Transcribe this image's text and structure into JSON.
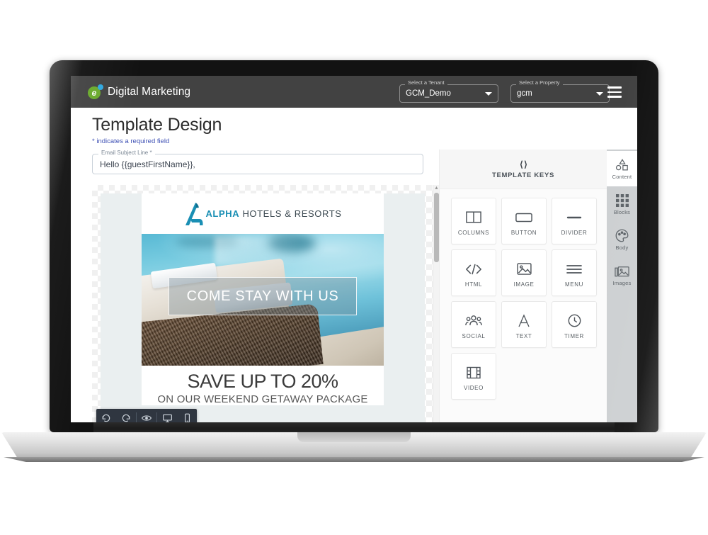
{
  "app": {
    "brand_title": "Digital Marketing",
    "logo_letter": "e",
    "menu_icon": "hamburger-menu-icon"
  },
  "header": {
    "tenant": {
      "legend": "Select a Tenant",
      "value": "GCM_Demo"
    },
    "property": {
      "legend": "Select a Property",
      "value": "gcm"
    }
  },
  "page": {
    "title": "Template Design",
    "required_note": "* indicates a required field"
  },
  "subject": {
    "legend": "Email Subject Line *",
    "value": "Hello {{guestFirstName}},"
  },
  "email_preview": {
    "logo_prefix": "A",
    "logo_brand": "ALPHA",
    "logo_suffix": "HOTELS & RESORTS",
    "hero_text": "COME STAY WITH US",
    "promo_headline": "SAVE UP TO 20%",
    "promo_subline": "ON OUR WEEKEND GETAWAY PACKAGE"
  },
  "edit_toolbar": [
    {
      "name": "undo-icon",
      "label": "Undo"
    },
    {
      "name": "redo-icon",
      "label": "Redo"
    },
    {
      "name": "preview-eye-icon",
      "label": "Preview"
    },
    {
      "name": "desktop-view-icon",
      "label": "Desktop"
    },
    {
      "name": "mobile-view-icon",
      "label": "Mobile"
    }
  ],
  "keys_panel": {
    "icon": "code-brackets-icon",
    "title": "TEMPLATE KEYS"
  },
  "blocks": [
    {
      "label": "COLUMNS",
      "icon": "columns-icon"
    },
    {
      "label": "BUTTON",
      "icon": "button-icon"
    },
    {
      "label": "DIVIDER",
      "icon": "divider-icon"
    },
    {
      "label": "HTML",
      "icon": "html-code-icon"
    },
    {
      "label": "IMAGE",
      "icon": "image-icon"
    },
    {
      "label": "MENU",
      "icon": "menu-lines-icon"
    },
    {
      "label": "SOCIAL",
      "icon": "social-people-icon"
    },
    {
      "label": "TEXT",
      "icon": "text-letter-a-icon"
    },
    {
      "label": "TIMER",
      "icon": "clock-timer-icon"
    },
    {
      "label": "VIDEO",
      "icon": "video-film-icon"
    }
  ],
  "tool_rail": [
    {
      "label": "Content",
      "icon": "shapes-content-icon",
      "active": true
    },
    {
      "label": "Blocks",
      "icon": "grid-blocks-icon",
      "active": false
    },
    {
      "label": "Body",
      "icon": "palette-body-icon",
      "active": false
    },
    {
      "label": "Images",
      "icon": "images-stack-icon",
      "active": false
    }
  ],
  "colors": {
    "app_bar": "#424242",
    "accent_blue": "#3f51b5",
    "logo_green": "#6aaa2b",
    "logo_blue": "#2fa8e0",
    "brand_teal": "#1a8fb4",
    "rail_bg": "#cdd0d2",
    "toolbar_dark": "#2f3640"
  }
}
